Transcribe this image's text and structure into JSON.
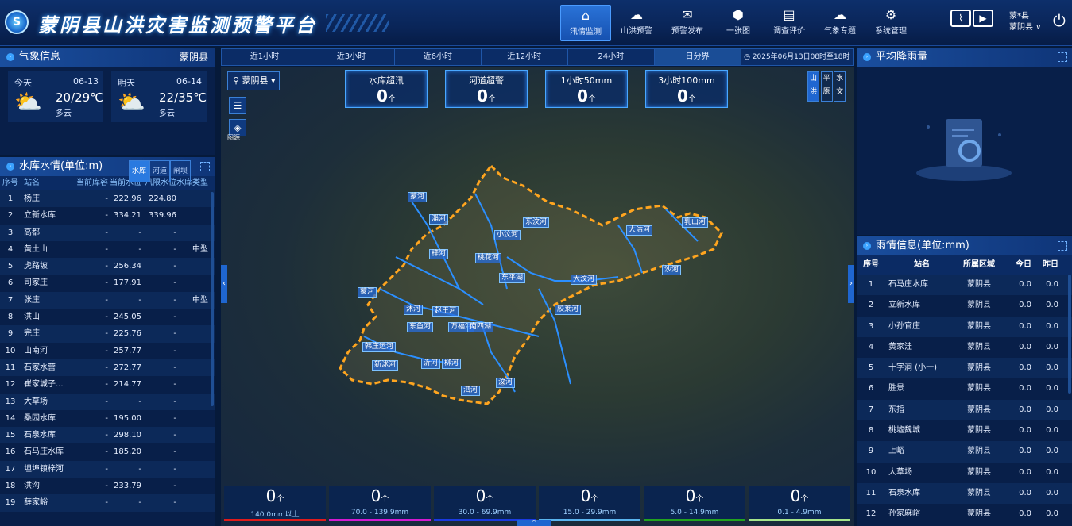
{
  "header": {
    "logo": "S",
    "title": "蒙阴县山洪灾害监测预警平台",
    "nav": [
      {
        "label": "汛情监测",
        "icon": "home-icon",
        "active": true
      },
      {
        "label": "山洪预警",
        "icon": "weather-icon",
        "active": false
      },
      {
        "label": "预警发布",
        "icon": "send-icon",
        "active": false
      },
      {
        "label": "一张图",
        "icon": "map-pin-icon",
        "active": false
      },
      {
        "label": "调查评价",
        "icon": "report-icon",
        "active": false
      },
      {
        "label": "气象专题",
        "icon": "weather-icon",
        "active": false
      },
      {
        "label": "系统管理",
        "icon": "settings-icon",
        "active": false
      }
    ],
    "user_name": "蒙*县",
    "user_region": "蒙阴县 ∨"
  },
  "weather": {
    "title": "气象信息",
    "region": "蒙阴县",
    "days": [
      {
        "label": "今天",
        "date": "06-13",
        "temp": "20/29℃",
        "cond": "多云",
        "icon": "partly-cloudy-icon"
      },
      {
        "label": "明天",
        "date": "06-14",
        "temp": "22/35℃",
        "cond": "多云",
        "icon": "partly-cloudy-icon"
      }
    ]
  },
  "reservoir": {
    "title": "水库水情(单位:m)",
    "tabs": [
      "水库",
      "河道",
      "闸坝"
    ],
    "headers": [
      "序号",
      "站名",
      "当前库容",
      "当前水位",
      "汛限水位",
      "水库类型"
    ],
    "rows": [
      [
        "1",
        "杨庄",
        "-",
        "222.96",
        "224.80",
        ""
      ],
      [
        "2",
        "立新水库",
        "-",
        "334.21",
        "339.96",
        ""
      ],
      [
        "3",
        "高都",
        "-",
        "-",
        "-",
        ""
      ],
      [
        "4",
        "黄土山",
        "-",
        "-",
        "-",
        "中型"
      ],
      [
        "5",
        "虎路坡",
        "-",
        "256.34",
        "-",
        ""
      ],
      [
        "6",
        "司家庄",
        "-",
        "177.91",
        "-",
        ""
      ],
      [
        "7",
        "张庄",
        "-",
        "-",
        "-",
        "中型"
      ],
      [
        "8",
        "洪山",
        "-",
        "245.05",
        "-",
        ""
      ],
      [
        "9",
        "完庄",
        "-",
        "225.76",
        "-",
        ""
      ],
      [
        "10",
        "山南河",
        "-",
        "257.77",
        "-",
        ""
      ],
      [
        "11",
        "石家水营",
        "-",
        "272.77",
        "-",
        ""
      ],
      [
        "12",
        "崔家城子...",
        "-",
        "214.77",
        "-",
        ""
      ],
      [
        "13",
        "大草场",
        "-",
        "-",
        "-",
        ""
      ],
      [
        "14",
        "桑园水库",
        "-",
        "195.00",
        "-",
        ""
      ],
      [
        "15",
        "石泉水库",
        "-",
        "298.10",
        "-",
        ""
      ],
      [
        "16",
        "石马庄水库",
        "-",
        "185.20",
        "-",
        ""
      ],
      [
        "17",
        "坦埠镇梓河",
        "-",
        "-",
        "-",
        ""
      ],
      [
        "18",
        "洪沟",
        "-",
        "233.79",
        "-",
        ""
      ],
      [
        "19",
        "薛家峪",
        "-",
        "-",
        "-",
        ""
      ]
    ]
  },
  "time_tabs": [
    "近1小时",
    "近3小时",
    "近6小时",
    "近12小时",
    "24小时",
    "日分界"
  ],
  "time_range": "2025年06月13日08时至18时",
  "map": {
    "county": "蒙阴县",
    "layer_label": "图源",
    "stats": [
      {
        "label": "水库超汛",
        "value": "0",
        "unit": "个"
      },
      {
        "label": "河道超警",
        "value": "0",
        "unit": "个"
      },
      {
        "label": "1小时50mm",
        "value": "0",
        "unit": "个"
      },
      {
        "label": "3小时100mm",
        "value": "0",
        "unit": "个"
      }
    ],
    "types": [
      [
        "山",
        "洪"
      ],
      [
        "平",
        "原"
      ],
      [
        "水",
        "文"
      ]
    ],
    "rivers": [
      "蒙河",
      "淄河",
      "小汶河",
      "东汶河",
      "梓河",
      "桃花河",
      "蒙河",
      "东平湖",
      "大汶河",
      "沭河",
      "赵王河",
      "东鱼河",
      "万福河",
      "南四湖",
      "韩庄运河",
      "新沭河",
      "沂河",
      "柳河",
      "泗河",
      "汶河",
      "胶莱河",
      "大沽河",
      "乳山河",
      "沙河"
    ],
    "legend": [
      {
        "value": "0",
        "unit": "个",
        "range": "140.0mm以上",
        "color": "#e01b1b"
      },
      {
        "value": "0",
        "unit": "个",
        "range": "70.0 - 139.9mm",
        "color": "#d31ad3"
      },
      {
        "value": "0",
        "unit": "个",
        "range": "30.0 - 69.9mm",
        "color": "#1a3ae0"
      },
      {
        "value": "0",
        "unit": "个",
        "range": "15.0 - 29.9mm",
        "color": "#5ab5f0"
      },
      {
        "value": "0",
        "unit": "个",
        "range": "5.0 - 14.9mm",
        "color": "#22a31e"
      },
      {
        "value": "0",
        "unit": "个",
        "range": "0.1 - 4.9mm",
        "color": "#a6e68c"
      }
    ]
  },
  "avg_rain": {
    "title": "平均降雨量"
  },
  "rain_info": {
    "title": "雨情信息(单位:mm)",
    "headers": [
      "序号",
      "站名",
      "所属区域",
      "今日",
      "昨日"
    ],
    "rows": [
      [
        "1",
        "石马庄水库",
        "蒙阴县",
        "0.0",
        "0.0"
      ],
      [
        "2",
        "立新水库",
        "蒙阴县",
        "0.0",
        "0.0"
      ],
      [
        "3",
        "小孙官庄",
        "蒙阴县",
        "0.0",
        "0.0"
      ],
      [
        "4",
        "黄家洼",
        "蒙阴县",
        "0.0",
        "0.0"
      ],
      [
        "5",
        "十字涧 (小一)",
        "蒙阴县",
        "0.0",
        "0.0"
      ],
      [
        "6",
        "胜景",
        "蒙阴县",
        "0.0",
        "0.0"
      ],
      [
        "7",
        "东指",
        "蒙阴县",
        "0.0",
        "0.0"
      ],
      [
        "8",
        "桃墟魏城",
        "蒙阴县",
        "0.0",
        "0.0"
      ],
      [
        "9",
        "上峪",
        "蒙阴县",
        "0.0",
        "0.0"
      ],
      [
        "10",
        "大草场",
        "蒙阴县",
        "0.0",
        "0.0"
      ],
      [
        "11",
        "石泉水库",
        "蒙阴县",
        "0.0",
        "0.0"
      ],
      [
        "12",
        "孙家麻峪",
        "蒙阴县",
        "0.0",
        "0.0"
      ]
    ]
  }
}
